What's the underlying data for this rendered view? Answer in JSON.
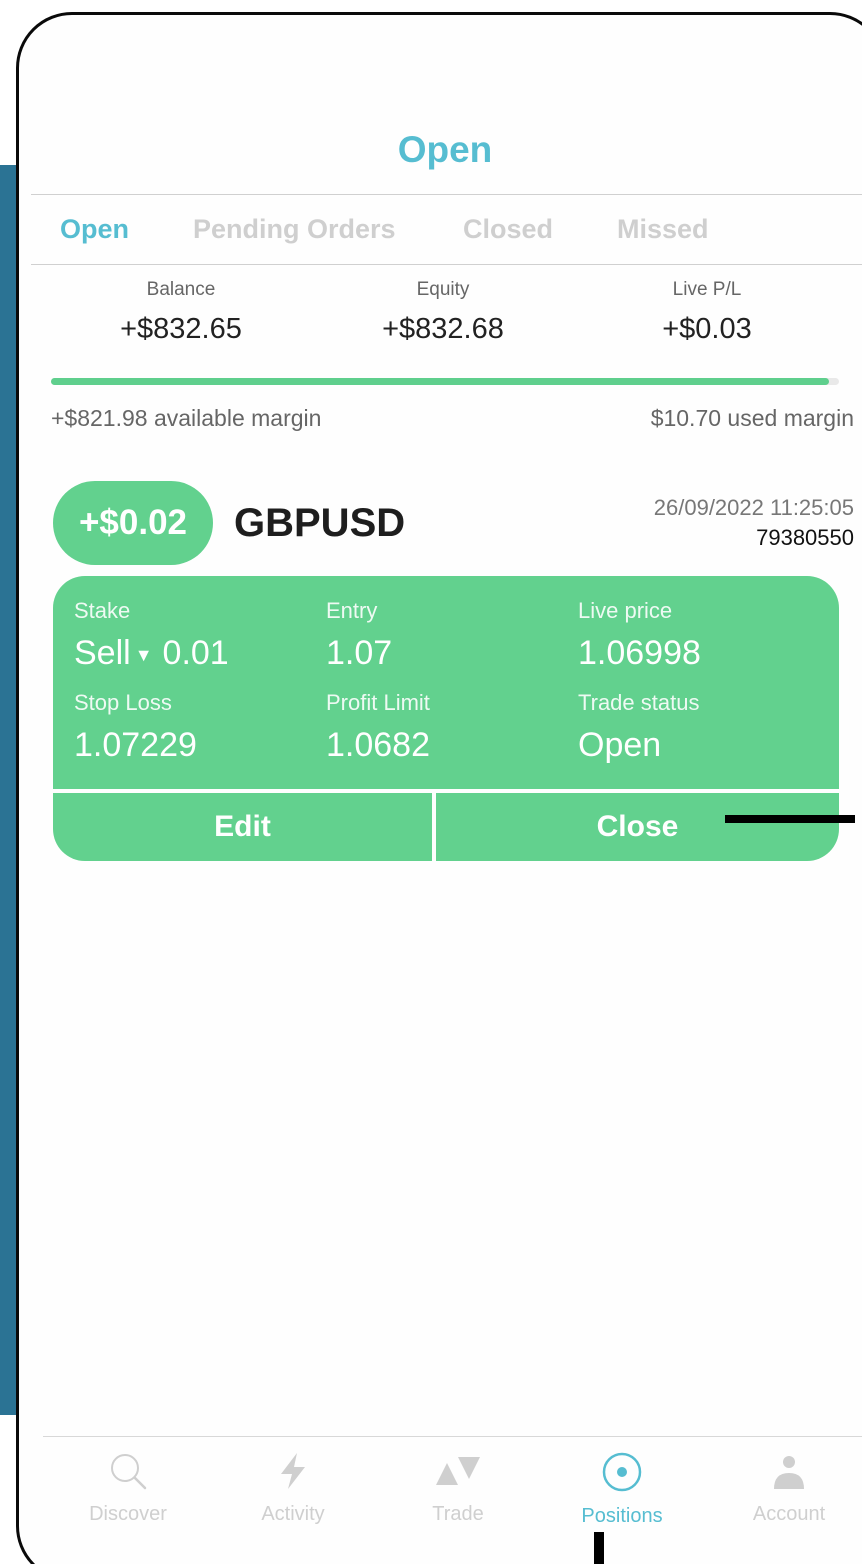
{
  "header": {
    "title": "Open"
  },
  "tabs": [
    {
      "label": "Open",
      "active": true
    },
    {
      "label": "Pending Orders",
      "active": false
    },
    {
      "label": "Closed",
      "active": false
    },
    {
      "label": "Missed",
      "active": false
    }
  ],
  "summary": {
    "balance": {
      "label": "Balance",
      "value": "+$832.65"
    },
    "equity": {
      "label": "Equity",
      "value": "+$832.68"
    },
    "live_pl": {
      "label": "Live P/L",
      "value": "+$0.03"
    }
  },
  "margin": {
    "used_fraction": 0.987,
    "available_text": "+$821.98 available margin",
    "used_text": "$10.70 used margin"
  },
  "position": {
    "pl": "+$0.02",
    "symbol": "GBPUSD",
    "datetime": "26/09/2022 11:25:05",
    "id": "79380550",
    "fields": {
      "stake": {
        "label": "Stake",
        "side": "Sell",
        "amount": "0.01"
      },
      "entry": {
        "label": "Entry",
        "value": "1.07"
      },
      "live_price": {
        "label": "Live price",
        "value": "1.06998"
      },
      "stop_loss": {
        "label": "Stop Loss",
        "value": "1.07229"
      },
      "profit_limit": {
        "label": "Profit Limit",
        "value": "1.0682"
      },
      "trade_status": {
        "label": "Trade status",
        "value": "Open"
      }
    },
    "edit_label": "Edit",
    "close_label": "Close"
  },
  "nav": [
    {
      "label": "Discover",
      "icon": "search-icon",
      "active": false
    },
    {
      "label": "Activity",
      "icon": "lightning-icon",
      "active": false
    },
    {
      "label": "Trade",
      "icon": "trade-arrows-icon",
      "active": false
    },
    {
      "label": "Positions",
      "icon": "target-icon",
      "active": true
    },
    {
      "label": "Account",
      "icon": "person-icon",
      "active": false
    }
  ],
  "colors": {
    "accent": "#56bdd1",
    "positive": "#62d18e",
    "side_strip": "#2b7394"
  }
}
